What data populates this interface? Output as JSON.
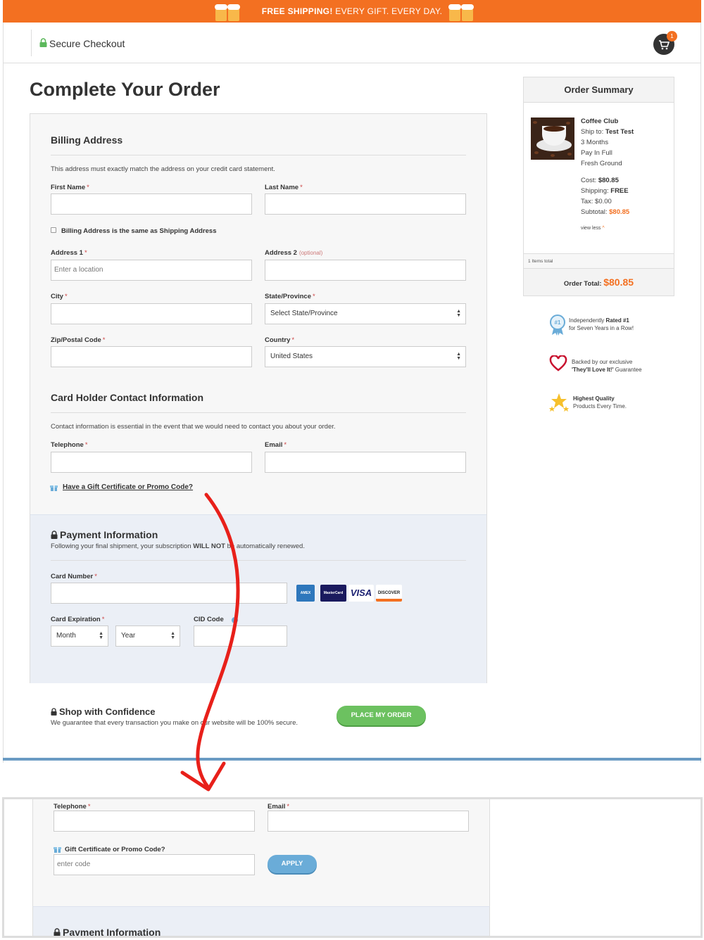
{
  "promo": {
    "strong": "FREE SHIPPING!",
    "rest": " EVERY GIFT. EVERY DAY."
  },
  "header": {
    "title": "Secure Checkout",
    "cart_count": "1"
  },
  "page_title": "Complete Your Order",
  "billing": {
    "title": "Billing Address",
    "note": "This address must exactly match the address on your credit card statement.",
    "first_name": "First Name",
    "last_name": "Last Name",
    "same_as_shipping": "Billing Address is the same as Shipping Address",
    "address1": "Address 1",
    "address1_placeholder": "Enter a location",
    "address2": "Address 2",
    "optional": "(optional)",
    "city": "City",
    "state": "State/Province",
    "state_value": "Select State/Province",
    "zip": "Zip/Postal Code",
    "country": "Country",
    "country_value": "United States",
    "req": "*"
  },
  "contact": {
    "title": "Card Holder Contact Information",
    "note": "Contact information is essential in the event that we would need to contact you about your order.",
    "telephone": "Telephone",
    "email": "Email",
    "promo_link": "Have a Gift Certificate or Promo Code?"
  },
  "payment": {
    "title": "Payment Information",
    "note_pre": "Following your final shipment, your subscription ",
    "note_bold": "WILL NOT",
    "note_post": " be automatically renewed.",
    "card_number": "Card Number",
    "card_expiration": "Card Expiration",
    "cid_code": "CID Code",
    "month": "Month",
    "year": "Year",
    "logos": {
      "amex": "AMEX",
      "mastercard": "MasterCard",
      "visa": "VISA",
      "discover": "DISCOVER"
    }
  },
  "confidence": {
    "title": "Shop with Confidence",
    "note": "We guarantee that every transaction you make on our website will be 100% secure.",
    "button": "PLACE MY ORDER"
  },
  "summary": {
    "title": "Order Summary",
    "product": "Coffee Club",
    "ship_to_label": "Ship to: ",
    "ship_to": "Test Test",
    "duration": "3 Months",
    "payment": "Pay In Full",
    "grind": "Fresh Ground",
    "cost_label": "Cost: ",
    "cost": "$80.85",
    "shipping_label": "Shipping: ",
    "shipping": "FREE",
    "tax": "Tax: $0.00",
    "subtotal_label": "Subtotal: ",
    "subtotal": "$80.85",
    "view_less": "view less",
    "items_total": "1 Items total",
    "order_total_label": "Order Total: ",
    "order_total": "$80.85"
  },
  "badges": [
    {
      "pre": "Independently ",
      "bold": "Rated #1",
      "line2": "for Seven Years in a Row!"
    },
    {
      "pre": "Backed by our exclusive",
      "bold": "'They'll Love It!'",
      "line2": " Guarantee"
    },
    {
      "bold": "Highest Quality",
      "line2": "Products Every Time."
    }
  ],
  "zoom": {
    "telephone": "Telephone",
    "email": "Email",
    "promo_label": "Gift Certificate or Promo Code?",
    "code_placeholder": "enter code",
    "apply": "APPLY",
    "payment_title": "Payment Information"
  },
  "colors": {
    "brand_orange": "#f37021",
    "success_green": "#6cc160",
    "apply_blue": "#6aacd8",
    "arrow_red": "#e8201a"
  }
}
